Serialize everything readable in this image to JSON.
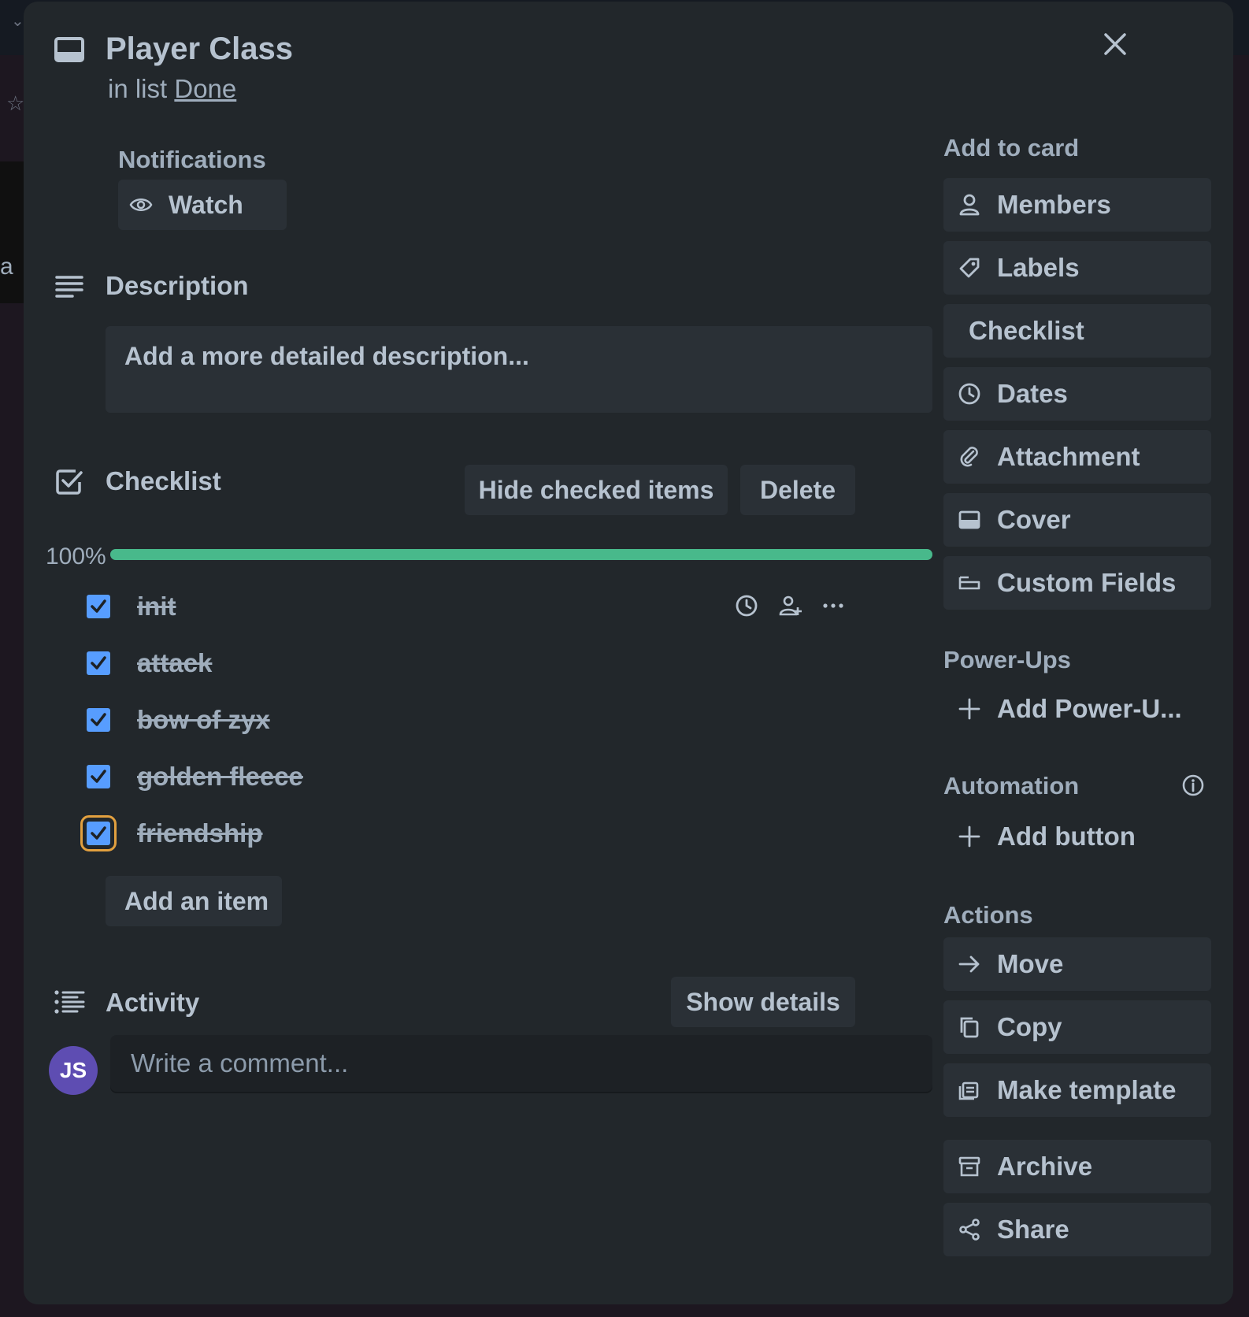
{
  "card": {
    "title": "Player Class",
    "list_prefix": "in list",
    "list_name": "Done"
  },
  "notifications": {
    "heading": "Notifications",
    "watch_label": "Watch"
  },
  "description": {
    "heading": "Description",
    "placeholder": "Add a more detailed description..."
  },
  "checklist": {
    "heading": "Checklist",
    "hide_checked_label": "Hide checked items",
    "delete_label": "Delete",
    "progress_text": "100%",
    "progress_fraction": 1.0,
    "items": [
      {
        "label": "init",
        "checked": true
      },
      {
        "label": "attack",
        "checked": true
      },
      {
        "label": "bow of zyx",
        "checked": true
      },
      {
        "label": "golden fleece",
        "checked": true
      },
      {
        "label": "friendship",
        "checked": true
      }
    ],
    "add_item_label": "Add an item"
  },
  "activity": {
    "heading": "Activity",
    "show_details_label": "Show details",
    "comment_placeholder": "Write a comment...",
    "avatar_initials": "JS"
  },
  "sidebar": {
    "add_to_card_heading": "Add to card",
    "add_to_card": [
      {
        "label": "Members",
        "icon": "person-icon"
      },
      {
        "label": "Labels",
        "icon": "tag-icon"
      },
      {
        "label": "Checklist",
        "icon": ""
      },
      {
        "label": "Dates",
        "icon": "clock-icon"
      },
      {
        "label": "Attachment",
        "icon": "paperclip-icon"
      },
      {
        "label": "Cover",
        "icon": "cover-icon"
      },
      {
        "label": "Custom Fields",
        "icon": "custom-fields-icon"
      }
    ],
    "powerups_heading": "Power-Ups",
    "add_powerup_label": "Add Power-U...",
    "automation_heading": "Automation",
    "add_button_label": "Add button",
    "actions_heading": "Actions",
    "actions": [
      {
        "label": "Move",
        "icon": "arrow-right-icon"
      },
      {
        "label": "Copy",
        "icon": "copy-icon"
      },
      {
        "label": "Make template",
        "icon": "template-icon"
      },
      {
        "label": "Archive",
        "icon": "archive-icon"
      },
      {
        "label": "Share",
        "icon": "share-icon"
      }
    ]
  },
  "colors": {
    "modal_bg": "#22272b",
    "button_bg": "#2a3036",
    "checkbox": "#579dff",
    "progress": "#4bce97",
    "avatar": "#5e4db2",
    "focus_ring": "#e2a03f"
  }
}
